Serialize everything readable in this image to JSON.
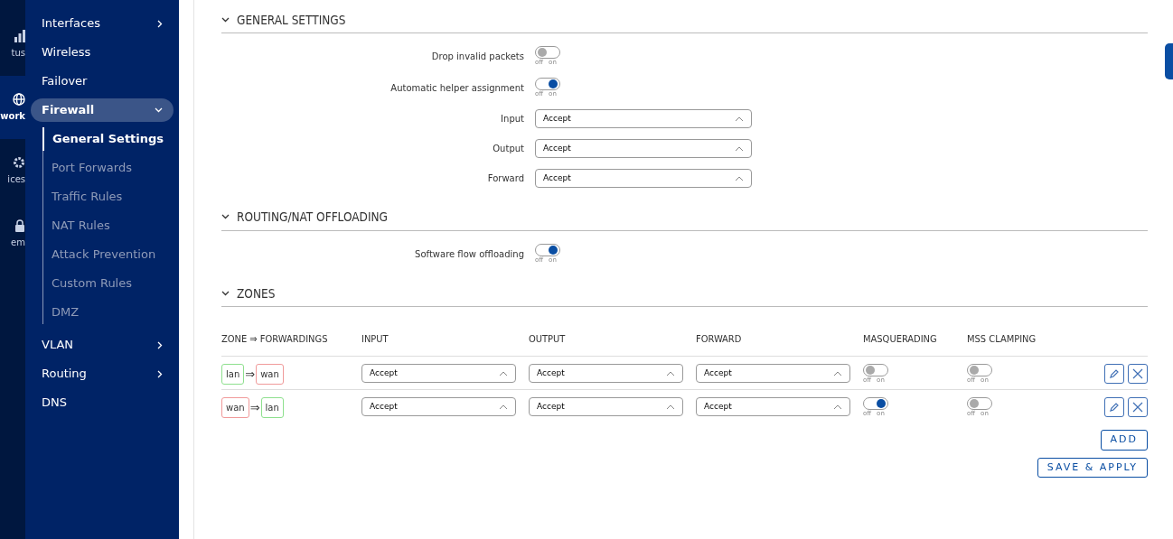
{
  "rail": [
    {
      "label": "tus",
      "selected": false
    },
    {
      "label": "work",
      "selected": true
    },
    {
      "label": "ices",
      "selected": false
    },
    {
      "label": "em",
      "selected": false
    }
  ],
  "sidebar": {
    "items": [
      {
        "label": "Interfaces",
        "kind": "group",
        "expanded": false,
        "selected": false
      },
      {
        "label": "Wireless",
        "kind": "link",
        "selected": false
      },
      {
        "label": "Failover",
        "kind": "link",
        "selected": false
      },
      {
        "label": "Firewall",
        "kind": "group",
        "expanded": true,
        "selected": true,
        "children": [
          {
            "label": "General Settings",
            "selected": true
          },
          {
            "label": "Port Forwards",
            "selected": false
          },
          {
            "label": "Traffic Rules",
            "selected": false
          },
          {
            "label": "NAT Rules",
            "selected": false
          },
          {
            "label": "Attack Prevention",
            "selected": false
          },
          {
            "label": "Custom Rules",
            "selected": false
          },
          {
            "label": "DMZ",
            "selected": false
          }
        ]
      },
      {
        "label": "VLAN",
        "kind": "group",
        "expanded": false,
        "selected": false
      },
      {
        "label": "Routing",
        "kind": "group",
        "expanded": false,
        "selected": false
      },
      {
        "label": "DNS",
        "kind": "link",
        "selected": false
      }
    ]
  },
  "sections": [
    {
      "title": "GENERAL SETTINGS",
      "kind": "form",
      "expanded": true,
      "fields": [
        {
          "kind": "toggle",
          "label": "Drop invalid packets",
          "on": false,
          "off_label": "off",
          "on_label": "on"
        },
        {
          "kind": "toggle",
          "label": "Automatic helper assignment",
          "on": true,
          "off_label": "off",
          "on_label": "on"
        },
        {
          "kind": "select",
          "label": "Input",
          "value": "Accept"
        },
        {
          "kind": "select",
          "label": "Output",
          "value": "Accept"
        },
        {
          "kind": "select",
          "label": "Forward",
          "value": "Accept"
        }
      ]
    },
    {
      "title": "ROUTING/NAT OFFLOADING",
      "kind": "form",
      "expanded": true,
      "fields": [
        {
          "kind": "toggle",
          "label": "Software flow offloading",
          "on": true,
          "off_label": "off",
          "on_label": "on"
        }
      ]
    },
    {
      "title": "ZONES",
      "kind": "table",
      "expanded": true,
      "columns": [
        "ZONE ⇒ FORWARDINGS",
        "INPUT",
        "OUTPUT",
        "FORWARD",
        "MASQUERADING",
        "MSS CLAMPING"
      ],
      "rows": [
        {
          "zone": {
            "name": "lan",
            "color": "#8ee08e"
          },
          "arrow": "⇒",
          "forwarding": {
            "name": "wan",
            "color": "#f09a9a"
          },
          "input": "Accept",
          "output": "Accept",
          "forward": "Accept",
          "masquerading": {
            "on": false,
            "off_label": "off",
            "on_label": "on"
          },
          "mss_clamping": {
            "on": false,
            "off_label": "off",
            "on_label": "on"
          }
        },
        {
          "zone": {
            "name": "wan",
            "color": "#f09a9a"
          },
          "arrow": "⇒",
          "forwarding": {
            "name": "lan",
            "color": "#8ee08e"
          },
          "input": "Accept",
          "output": "Accept",
          "forward": "Accept",
          "masquerading": {
            "on": true,
            "off_label": "off",
            "on_label": "on"
          },
          "mss_clamping": {
            "on": false,
            "off_label": "off",
            "on_label": "on"
          }
        }
      ],
      "buttons": [
        "ADD"
      ]
    }
  ],
  "footer_buttons": [
    "SAVE & APPLY"
  ]
}
